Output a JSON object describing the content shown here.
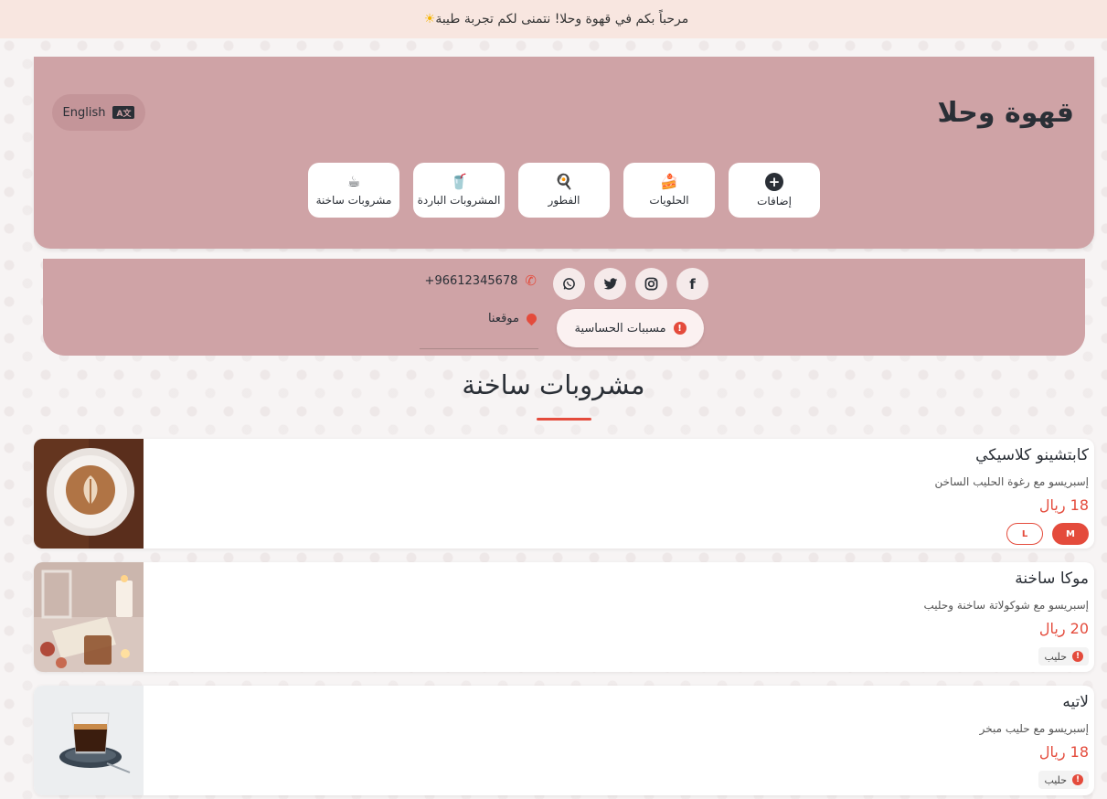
{
  "announcement": {
    "text": "مرحباً بكم في قهوة وحلا! نتمنى لكم تجربة طيبة",
    "icon": "sun-icon"
  },
  "header": {
    "brand": "قهوة وحلا",
    "language_button": "English",
    "categories": [
      {
        "label": "مشروبات ساخنة",
        "icon": "hot-coffee-icon"
      },
      {
        "label": "المشروبات الباردة",
        "icon": "cold-drink-icon"
      },
      {
        "label": "الفطور",
        "icon": "breakfast-icon"
      },
      {
        "label": "الحلويات",
        "icon": "cake-icon"
      },
      {
        "label": "إضافات",
        "icon": "plus-icon"
      }
    ]
  },
  "info": {
    "socials": [
      "facebook-icon",
      "instagram-icon",
      "twitter-icon",
      "whatsapp-icon"
    ],
    "allergy_button": "مسببات الحساسية",
    "phone": "+96612345678",
    "location": "موقعنا"
  },
  "section": {
    "title": "مشروبات ساخنة"
  },
  "products": [
    {
      "name": "كابتشينو كلاسيكي",
      "description": "إسبريسو مع رغوة الحليب الساخن",
      "price": "18 ريال",
      "sizes": [
        "M",
        "L"
      ],
      "selected_size": "M"
    },
    {
      "name": "موكا ساخنة",
      "description": "إسبريسو مع شوكولاتة ساخنة وحليب",
      "price": "20 ريال",
      "allergen": "حليب"
    },
    {
      "name": "لاتيه",
      "description": "إسبريسو مع حليب مبخر",
      "price": "18 ريال",
      "allergen": "حليب"
    }
  ],
  "colors": {
    "accent": "#e44b3c",
    "header_bg": "#cfa3a6",
    "announcement_bg": "#f8e6e0",
    "text": "#2a2f36"
  }
}
